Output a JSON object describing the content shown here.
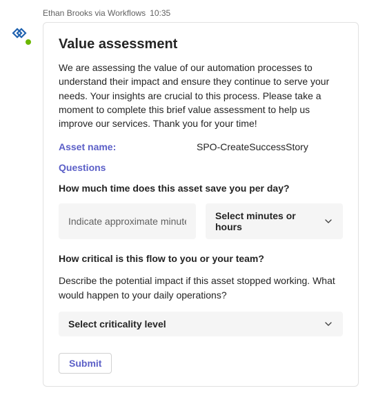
{
  "header": {
    "sender": "Ethan Brooks via Workflows",
    "timestamp": "10:35"
  },
  "avatar": {
    "icon_name": "workflows-icon",
    "presence": "available"
  },
  "card": {
    "title": "Value assessment",
    "description": "We are assessing the value of our automation processes to understand their impact and ensure they continue to serve your needs. Your insights are crucial to this process. Please take a moment to complete this brief value assessment to help us improve our services. Thank you for your time!",
    "asset_label": "Asset name:",
    "asset_value": "SPO-CreateSuccessStory",
    "questions_label": "Questions",
    "q1": {
      "text": "How much time does this asset save you per day?",
      "input_placeholder": "Indicate approximate minutes",
      "select_placeholder": "Select minutes or hours"
    },
    "q2": {
      "text": "How critical is this flow to you or your team?",
      "sub": "Describe the potential impact if this asset stopped working. What would happen to your daily operations?",
      "select_placeholder": "Select criticality level"
    },
    "submit_label": "Submit"
  }
}
